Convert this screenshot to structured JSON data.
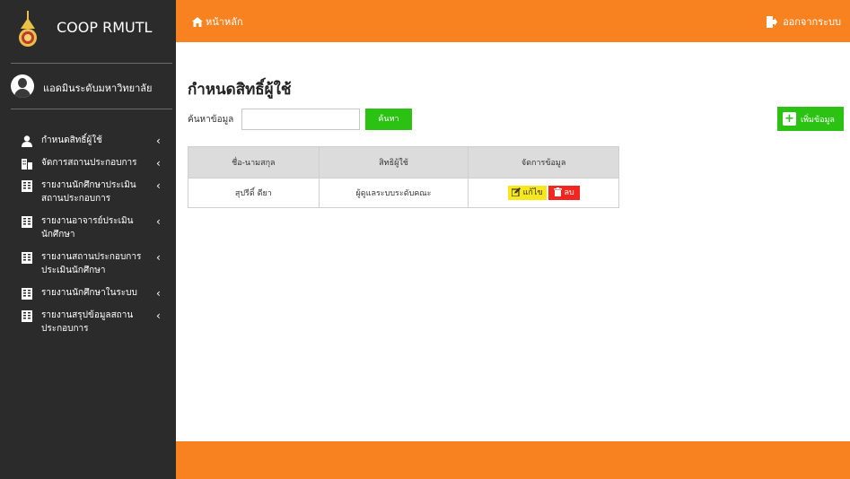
{
  "brand": {
    "title": "COOP RMUTL"
  },
  "user": {
    "name": "แอดมินระดับมหาวิทยาลัย"
  },
  "sidebar": {
    "items": [
      {
        "label": "กำหนดสิทธิ์ผู้ใช้",
        "icon": "user-icon"
      },
      {
        "label": "จัดการสถานประกอบการ",
        "icon": "building-icon"
      },
      {
        "label": "รายงานนักศึกษาประเมินสถานประกอบการ",
        "icon": "report-icon"
      },
      {
        "label": "รายงานอาจารย์ประเมินนักศึกษา",
        "icon": "report-icon"
      },
      {
        "label": "รายงานสถานประกอบการประเมินนักศึกษา",
        "icon": "report-icon"
      },
      {
        "label": "รายงานนักศึกษาในระบบ",
        "icon": "report-icon"
      },
      {
        "label": "รายงานสรุปข้อมูลสถานประกอบการ",
        "icon": "report-icon"
      }
    ]
  },
  "topbar": {
    "home_label": "หน้าหลัก",
    "logout_label": "ออกจากระบบ"
  },
  "main": {
    "title": "กำหนดสิทธิ์ผู้ใช้",
    "search_label": "ค้นหาข้อมูล",
    "search_value": "",
    "search_button": "ค้นหา",
    "add_button": "เพิ่มข้อมูล"
  },
  "table": {
    "headers": [
      "ชื่อ-นามสกุล",
      "สิทธิผู้ใช้",
      "จัดการข้อมูล"
    ],
    "rows": [
      {
        "name": "สุปรีดิ์ ดียา",
        "role": "ผู้ดูแลระบบระดับคณะ",
        "edit": "แก้ไข",
        "delete": "ลบ"
      }
    ]
  },
  "colors": {
    "accent": "#f7821f",
    "sidebar": "#2b2b2b",
    "success": "#2bc214",
    "warning": "#f8e71c",
    "danger": "#f2261f"
  }
}
